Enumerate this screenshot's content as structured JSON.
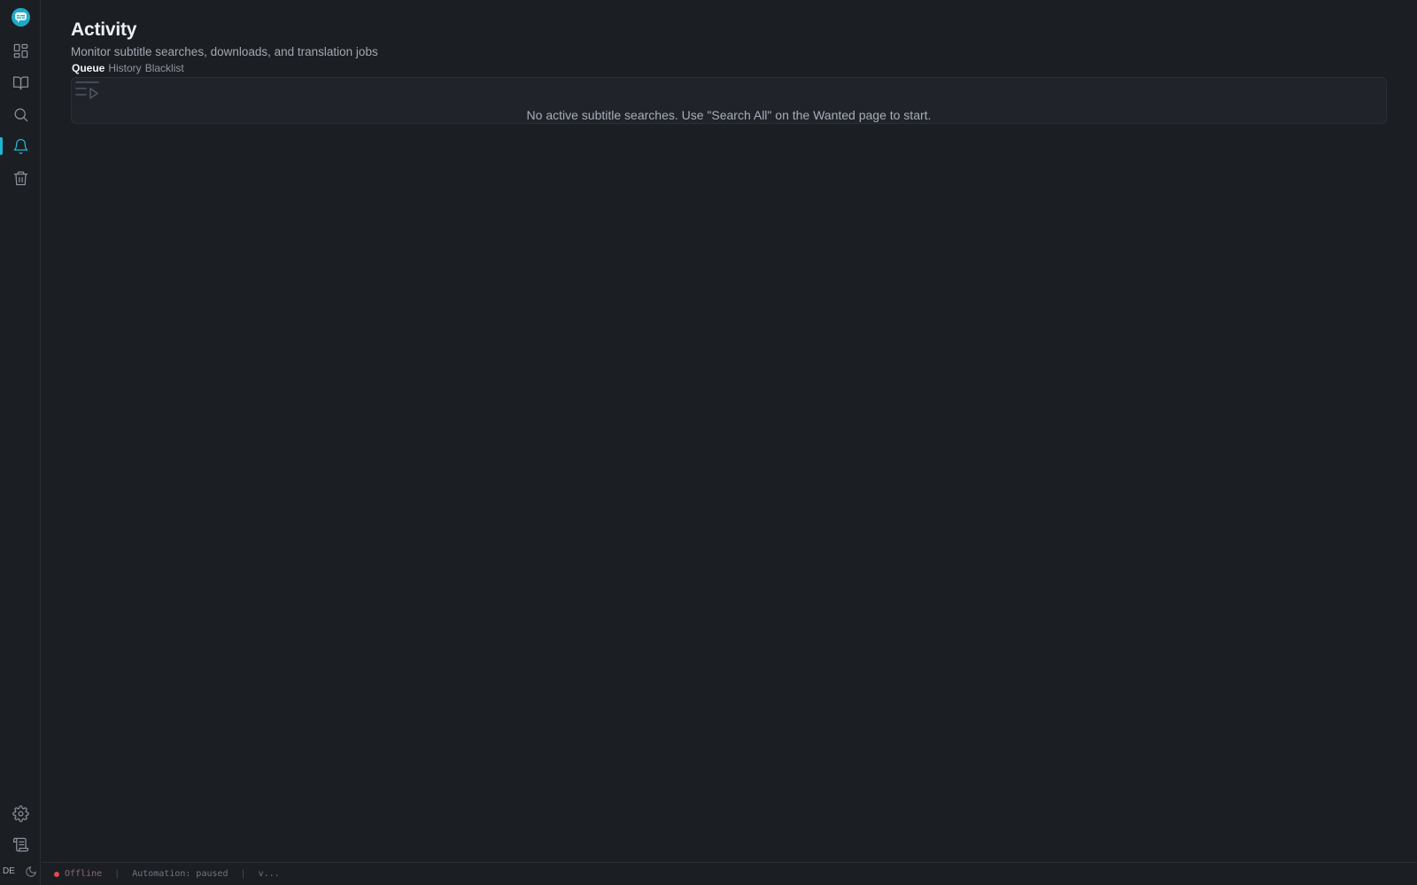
{
  "colors": {
    "accent": "#1fb6d3",
    "background": "#1b1e23",
    "panel": "#20242a",
    "status_offline": "#e5484d"
  },
  "sidebar": {
    "logo_icon": "subtitle-bubble-logo-icon",
    "items": [
      {
        "icon": "dashboard-grid-icon",
        "active": false
      },
      {
        "icon": "book-open-icon",
        "active": false
      },
      {
        "icon": "search-icon",
        "active": false
      },
      {
        "icon": "bell-icon",
        "active": true
      },
      {
        "icon": "trash-icon",
        "active": false
      }
    ],
    "bottom_items": [
      {
        "icon": "gear-icon"
      },
      {
        "icon": "scroll-log-icon"
      }
    ],
    "language": "DE",
    "theme_icon": "moon-icon"
  },
  "header": {
    "title": "Activity",
    "subtitle": "Monitor subtitle searches, downloads, and translation jobs"
  },
  "tabs": [
    {
      "label": "Queue",
      "active": true
    },
    {
      "label": "History",
      "active": false
    },
    {
      "label": "Blacklist",
      "active": false
    }
  ],
  "queue": {
    "icon": "list-play-icon",
    "empty_message": "No active subtitle searches. Use \"Search All\" on the Wanted page to start."
  },
  "statusbar": {
    "connection": "Offline",
    "automation": "Automation: paused",
    "version": "v..."
  }
}
